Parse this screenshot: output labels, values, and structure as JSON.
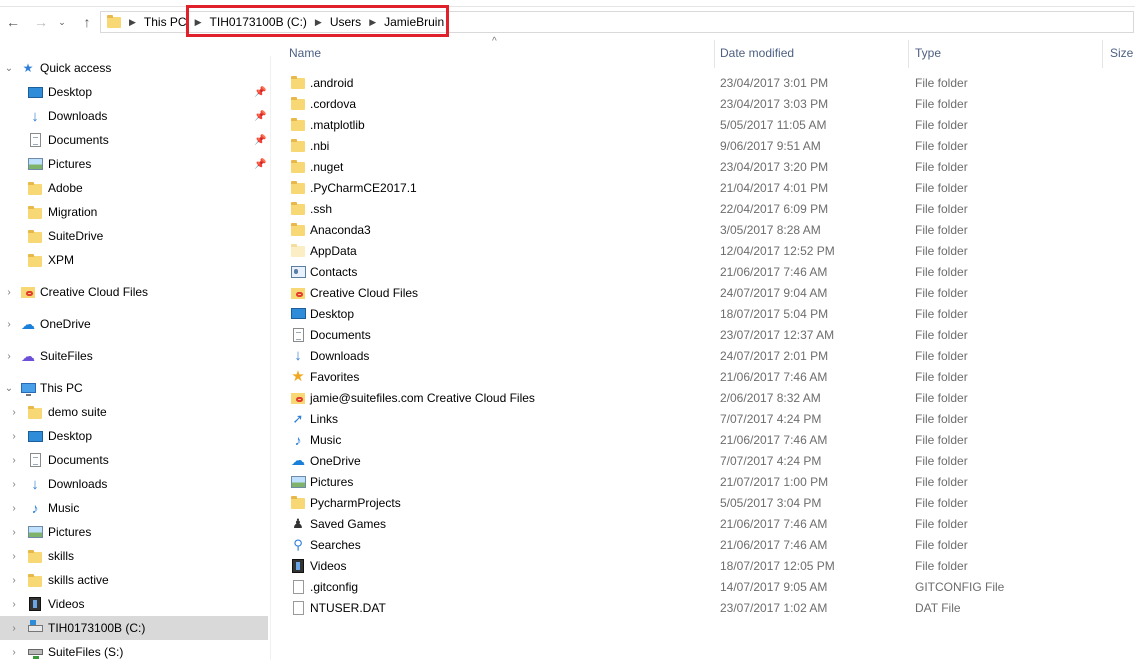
{
  "address": {
    "crumbs": [
      "This PC",
      "TIH0173100B (C:)",
      "Users",
      "JamieBruin"
    ]
  },
  "columns": {
    "name": "Name",
    "date": "Date modified",
    "type": "Type",
    "size": "Size"
  },
  "sidebar": {
    "items": [
      {
        "label": "Quick access",
        "icon": "star-icon"
      },
      {
        "label": "Desktop",
        "icon": "desktop-icon"
      },
      {
        "label": "Downloads",
        "icon": "downloads-icon"
      },
      {
        "label": "Documents",
        "icon": "documents-icon"
      },
      {
        "label": "Pictures",
        "icon": "pictures-icon"
      },
      {
        "label": "Adobe",
        "icon": "folder-icon"
      },
      {
        "label": "Migration",
        "icon": "folder-icon"
      },
      {
        "label": "SuiteDrive",
        "icon": "folder-icon"
      },
      {
        "label": "XPM",
        "icon": "folder-icon"
      },
      {
        "label": "Creative Cloud Files",
        "icon": "creative-cloud-folder-icon"
      },
      {
        "label": "OneDrive",
        "icon": "onedrive-icon"
      },
      {
        "label": "SuiteFiles",
        "icon": "suitefiles-icon"
      },
      {
        "label": "This PC",
        "icon": "computer-icon"
      },
      {
        "label": "demo suite",
        "icon": "folder-icon"
      },
      {
        "label": "Desktop",
        "icon": "desktop-icon"
      },
      {
        "label": "Documents",
        "icon": "documents-icon"
      },
      {
        "label": "Downloads",
        "icon": "downloads-icon"
      },
      {
        "label": "Music",
        "icon": "music-icon"
      },
      {
        "label": "Pictures",
        "icon": "pictures-icon"
      },
      {
        "label": "skills",
        "icon": "shared-folder-icon"
      },
      {
        "label": "skills active",
        "icon": "shared-folder-icon"
      },
      {
        "label": "Videos",
        "icon": "videos-icon"
      },
      {
        "label": "TIH0173100B (C:)",
        "icon": "local-drive-icon"
      },
      {
        "label": "SuiteFiles (S:)",
        "icon": "network-drive-icon"
      }
    ]
  },
  "files": [
    {
      "name": ".android",
      "date": "23/04/2017 3:01 PM",
      "type": "File folder",
      "icon": "folder-icon"
    },
    {
      "name": ".cordova",
      "date": "23/04/2017 3:03 PM",
      "type": "File folder",
      "icon": "folder-icon"
    },
    {
      "name": ".matplotlib",
      "date": "5/05/2017 11:05 AM",
      "type": "File folder",
      "icon": "folder-icon"
    },
    {
      "name": ".nbi",
      "date": "9/06/2017 9:51 AM",
      "type": "File folder",
      "icon": "folder-icon"
    },
    {
      "name": ".nuget",
      "date": "23/04/2017 3:20 PM",
      "type": "File folder",
      "icon": "folder-icon"
    },
    {
      "name": ".PyCharmCE2017.1",
      "date": "21/04/2017 4:01 PM",
      "type": "File folder",
      "icon": "folder-icon"
    },
    {
      "name": ".ssh",
      "date": "22/04/2017 6:09 PM",
      "type": "File folder",
      "icon": "folder-icon"
    },
    {
      "name": "Anaconda3",
      "date": "3/05/2017 8:28 AM",
      "type": "File folder",
      "icon": "folder-icon"
    },
    {
      "name": "AppData",
      "date": "12/04/2017 12:52 PM",
      "type": "File folder",
      "icon": "hidden-folder-icon"
    },
    {
      "name": "Contacts",
      "date": "21/06/2017 7:46 AM",
      "type": "File folder",
      "icon": "contacts-icon"
    },
    {
      "name": "Creative Cloud Files",
      "date": "24/07/2017 9:04 AM",
      "type": "File folder",
      "icon": "creative-cloud-folder-icon"
    },
    {
      "name": "Desktop",
      "date": "18/07/2017 5:04 PM",
      "type": "File folder",
      "icon": "desktop-icon"
    },
    {
      "name": "Documents",
      "date": "23/07/2017 12:37 AM",
      "type": "File folder",
      "icon": "documents-icon"
    },
    {
      "name": "Downloads",
      "date": "24/07/2017 2:01 PM",
      "type": "File folder",
      "icon": "downloads-icon"
    },
    {
      "name": "Favorites",
      "date": "21/06/2017 7:46 AM",
      "type": "File folder",
      "icon": "favorites-icon"
    },
    {
      "name": "jamie@suitefiles.com Creative Cloud Files",
      "date": "2/06/2017 8:32 AM",
      "type": "File folder",
      "icon": "creative-cloud-folder-icon"
    },
    {
      "name": "Links",
      "date": "7/07/2017 4:24 PM",
      "type": "File folder",
      "icon": "links-icon"
    },
    {
      "name": "Music",
      "date": "21/06/2017 7:46 AM",
      "type": "File folder",
      "icon": "music-icon"
    },
    {
      "name": "OneDrive",
      "date": "7/07/2017 4:24 PM",
      "type": "File folder",
      "icon": "onedrive-icon"
    },
    {
      "name": "Pictures",
      "date": "21/07/2017 1:00 PM",
      "type": "File folder",
      "icon": "pictures-icon"
    },
    {
      "name": "PycharmProjects",
      "date": "5/05/2017 3:04 PM",
      "type": "File folder",
      "icon": "folder-icon"
    },
    {
      "name": "Saved Games",
      "date": "21/06/2017 7:46 AM",
      "type": "File folder",
      "icon": "saved-games-icon"
    },
    {
      "name": "Searches",
      "date": "21/06/2017 7:46 AM",
      "type": "File folder",
      "icon": "searches-icon"
    },
    {
      "name": "Videos",
      "date": "18/07/2017 12:05 PM",
      "type": "File folder",
      "icon": "videos-icon"
    },
    {
      "name": ".gitconfig",
      "date": "14/07/2017 9:05 AM",
      "type": "GITCONFIG File",
      "icon": "file-icon"
    },
    {
      "name": "NTUSER.DAT",
      "date": "23/07/2017 1:02 AM",
      "type": "DAT File",
      "icon": "file-icon"
    }
  ]
}
